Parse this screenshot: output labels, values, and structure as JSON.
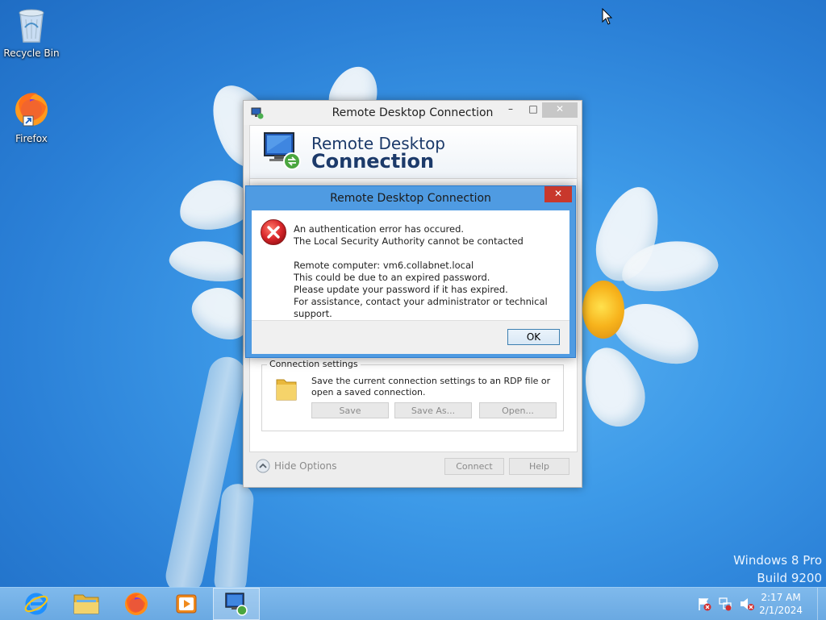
{
  "desktop": {
    "icons": [
      {
        "label": "Recycle Bin",
        "icon": "recycle-bin-icon"
      },
      {
        "label": "Firefox",
        "icon": "firefox-icon"
      }
    ],
    "watermark": {
      "line1": "Windows 8 Pro",
      "line2": "Build 9200"
    }
  },
  "rdc_window": {
    "title": "Remote Desktop Connection",
    "minimize_glyph": "–",
    "maximize_glyph": "□",
    "close_glyph": "✕",
    "banner_line1": "Remote Desktop",
    "banner_line2": "Connection",
    "connection_settings": {
      "legend": "Connection settings",
      "description": "Save the current connection settings to an RDP file or open a saved connection.",
      "save_label": "Save",
      "save_as_label": "Save As...",
      "open_label": "Open..."
    },
    "hide_options_label": "Hide Options",
    "connect_label": "Connect",
    "help_label": "Help"
  },
  "error_dialog": {
    "title": "Remote Desktop Connection",
    "close_glyph": "✕",
    "icon": "error-icon",
    "lines": [
      "An authentication error has occured.",
      "The Local Security Authority cannot be contacted",
      "",
      "Remote computer: vm6.collabnet.local",
      "This could be due to an expired password.",
      "Please update your password if it has expired.",
      "For assistance, contact your administrator or technical support."
    ],
    "ok_label": "OK"
  },
  "taskbar": {
    "apps": [
      {
        "name": "internet-explorer",
        "icon": "internet-explorer-icon"
      },
      {
        "name": "file-explorer",
        "icon": "folder-icon"
      },
      {
        "name": "firefox",
        "icon": "firefox-icon"
      },
      {
        "name": "media-player",
        "icon": "media-player-icon"
      },
      {
        "name": "remote-desktop",
        "icon": "remote-desktop-icon",
        "active": true
      }
    ],
    "tray_icons": [
      "action-center-icon",
      "network-icon",
      "volume-muted-icon"
    ],
    "time": "2:17 AM",
    "date": "2/1/2024"
  },
  "colors": {
    "desktop_bg": "#3d9ae8",
    "error_frame": "#4f9be2",
    "close_red": "#c8382c",
    "taskbar": "#6aa9e2"
  }
}
